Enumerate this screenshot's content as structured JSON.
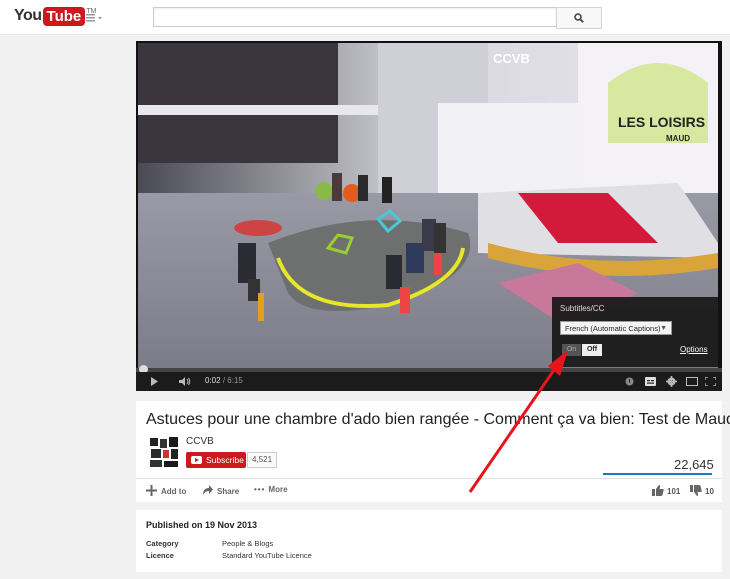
{
  "header": {
    "logo_you": "You",
    "logo_tube": "Tube",
    "logo_tm": "TM",
    "search": {
      "value": "",
      "placeholder": ""
    }
  },
  "player": {
    "time_current": "0:02",
    "time_duration": "6:15",
    "progress_fraction": 0.005,
    "video_overlay_text": "CCVB",
    "video_sign_line1": "LES LOISIRS",
    "video_sign_line2": "MAUD",
    "subtitles_menu": {
      "title": "Subtitles/CC",
      "language": "French (Automatic Captions)",
      "on_label": "On",
      "off_label": "Off",
      "options_label": "Options"
    }
  },
  "video_info": {
    "title": "Astuces pour une chambre d'ado bien rangée - Comment ça va bien: Test de Maud",
    "channel_name": "CCVB",
    "subscribe_label": "Subscribe",
    "subscriber_count": "4,521",
    "views": "22,645",
    "actions": {
      "add_to": "Add to",
      "share": "Share",
      "more": "More"
    },
    "likes": "101",
    "dislikes": "10"
  },
  "description": {
    "published": "Published on 19 Nov 2013",
    "category_label": "Category",
    "category_value": "People & Blogs",
    "licence_label": "Licence",
    "licence_value": "Standard YouTube Licence"
  },
  "colors": {
    "brand_red": "#cc181e",
    "view_bar_blue": "#167ac6",
    "annotation_arrow": "#e8141c"
  }
}
